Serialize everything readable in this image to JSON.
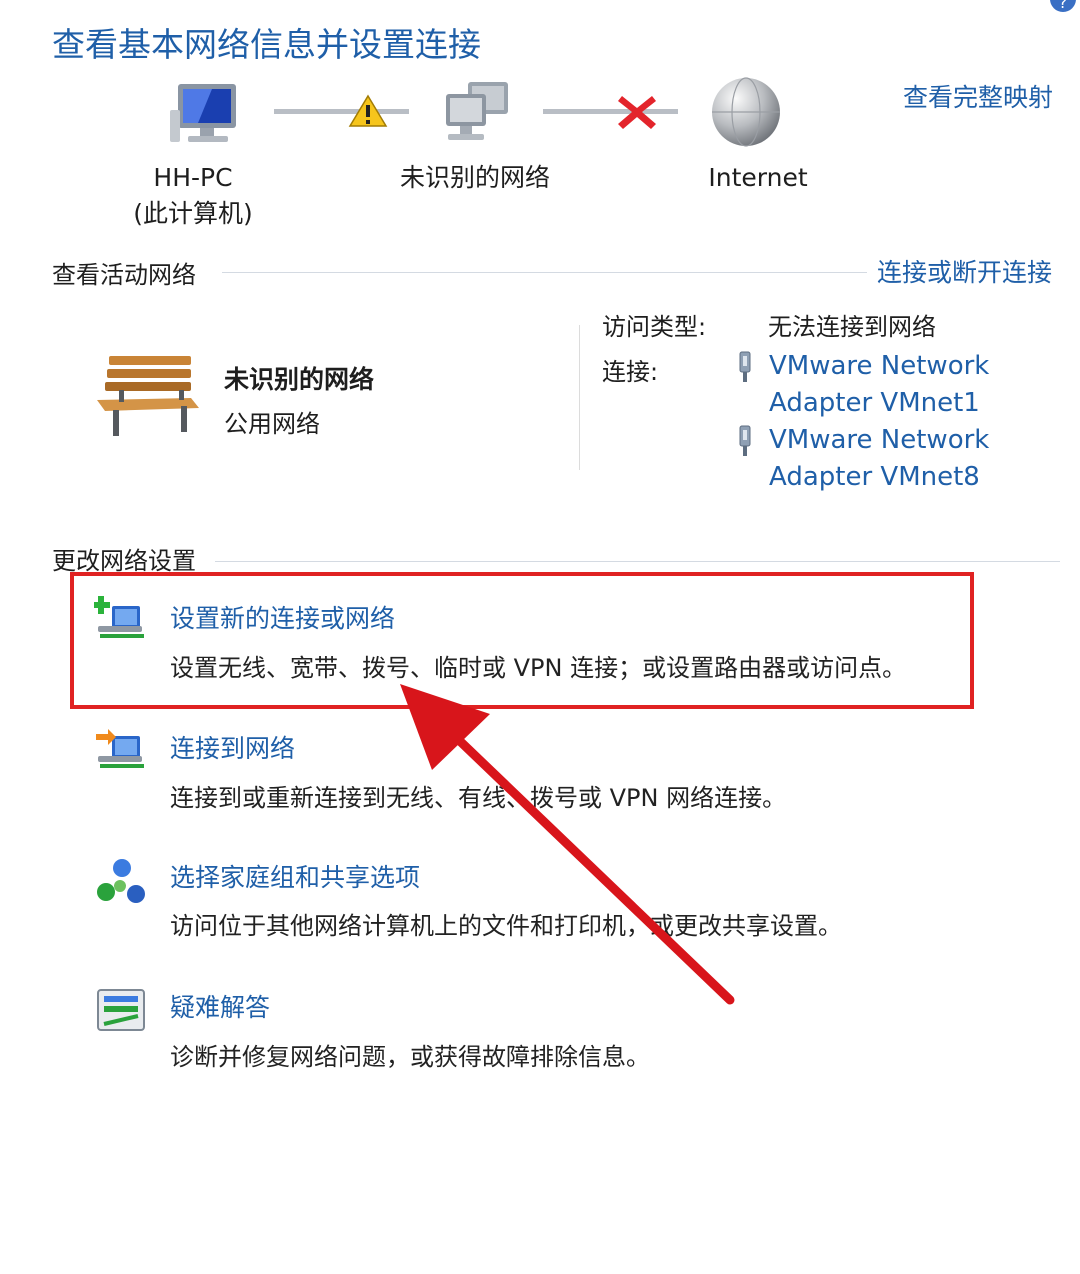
{
  "page_title": "查看基本网络信息并设置连接",
  "header_links": {
    "view_full_map": "查看完整映射"
  },
  "network_map": {
    "nodes": [
      {
        "label_line1": "HH-PC",
        "label_line2": "(此计算机)",
        "icon": "computer-icon"
      },
      {
        "label_line1": "未识别的网络",
        "icon": "network-icon"
      },
      {
        "label_line1": "Internet",
        "icon": "globe-icon"
      }
    ],
    "links": [
      {
        "status_icon": "warning-icon"
      },
      {
        "status_icon": "error-x-icon"
      }
    ]
  },
  "active_networks": {
    "header": "查看活动网络",
    "connect_link": "连接或断开连接",
    "network": {
      "name": "未识别的网络",
      "type": "公用网络",
      "icon": "bench-icon"
    },
    "access_type_label": "访问类型:",
    "access_type_value": "无法连接到网络",
    "connections_label": "连接:",
    "connections": [
      {
        "line1": "VMware Network",
        "line2": "Adapter VMnet1",
        "icon": "network-adapter-icon"
      },
      {
        "line1": "VMware Network",
        "line2": "Adapter VMnet8",
        "icon": "network-adapter-icon"
      }
    ]
  },
  "change_settings": {
    "header": "更改网络设置",
    "tasks": [
      {
        "title": "设置新的连接或网络",
        "desc": "设置无线、宽带、拨号、临时或 VPN 连接；或设置路由器或访问点。",
        "icon": "new-connection-icon"
      },
      {
        "title": "连接到网络",
        "desc": "连接到或重新连接到无线、有线、拨号或 VPN 网络连接。",
        "icon": "connect-network-icon"
      },
      {
        "title": "选择家庭组和共享选项",
        "desc": "访问位于其他网络计算机上的文件和打印机，或更改共享设置。",
        "icon": "homegroup-icon"
      },
      {
        "title": "疑难解答",
        "desc": "诊断并修复网络问题，或获得故障排除信息。",
        "icon": "troubleshoot-icon"
      }
    ]
  },
  "colors": {
    "link": "#1f5fa8",
    "highlight": "#e02222",
    "arrow": "#d8151b"
  }
}
